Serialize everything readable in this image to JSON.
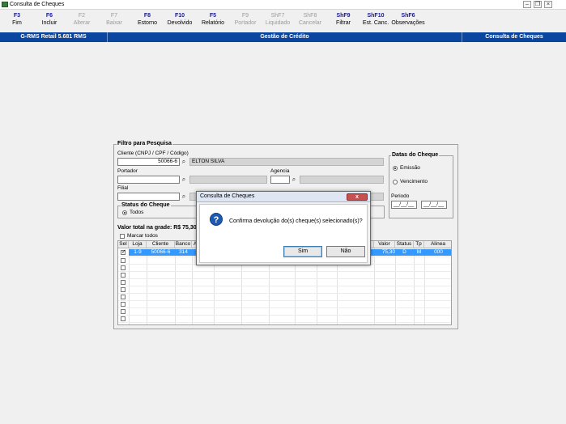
{
  "window": {
    "title": "Consulta de Cheques"
  },
  "toolbar": [
    {
      "key": "F3",
      "label": "Fim",
      "enabled": true
    },
    {
      "key": "F6",
      "label": "Incluir",
      "enabled": true
    },
    {
      "key": "F2",
      "label": "Alterar",
      "enabled": false
    },
    {
      "key": "F7",
      "label": "Baixar",
      "enabled": false
    },
    {
      "key": "F8",
      "label": "Estorno",
      "enabled": true
    },
    {
      "key": "F10",
      "label": "Devolvido",
      "enabled": true
    },
    {
      "key": "F5",
      "label": "Relatório",
      "enabled": true
    },
    {
      "key": "F9",
      "label": "Portador",
      "enabled": false
    },
    {
      "key": "ShF7",
      "label": "Liquidado",
      "enabled": false
    },
    {
      "key": "ShF8",
      "label": "Cancelar",
      "enabled": false
    },
    {
      "key": "ShF9",
      "label": "Filtrar",
      "enabled": true
    },
    {
      "key": "ShF10",
      "label": "Est. Canc.",
      "enabled": true
    },
    {
      "key": "ShF6",
      "label": "Observações",
      "enabled": true
    }
  ],
  "statusbar": {
    "app": "G-RMS Retail 5.681 RMS",
    "module": "Gestão de Crédito",
    "screen": "Consulta de Cheques"
  },
  "filter": {
    "title": "Filtro para Pesquisa",
    "cliente_label": "Cliente (CNPJ / CPF / Código)",
    "cliente_value": "50066-6",
    "cliente_name": "ELTON SILVA",
    "portador_label": "Portador",
    "agencia_label": "Agencia",
    "filial_label": "Filial"
  },
  "status_cheque": {
    "title": "Status do Cheque",
    "todos": "Todos"
  },
  "datas": {
    "title": "Datas do Cheque",
    "emissao": "Emissão",
    "vencimento": "Vencimento",
    "periodo_label": "Periodo",
    "date_from": "__/__/__",
    "date_to": "__/__/__"
  },
  "totals": {
    "label": "Valor total na grade: R$ 75,30",
    "marcar_todos": "Marcar todos"
  },
  "grid": {
    "columns": [
      "Sel",
      "Loja",
      "Cliente",
      "Banco",
      "A",
      "Valor",
      "Status",
      "Tp",
      "Alinea"
    ],
    "row": {
      "loja": "1-9",
      "cliente": "50066-6",
      "banco": "314",
      "valor": "75,30",
      "status": "D",
      "tp": "M",
      "alinea": "000"
    }
  },
  "dialog": {
    "title": "Consulta de Cheques",
    "close": "x",
    "message": "Confirma devolução do(s) cheque(s) selecionado(s)?",
    "yes": "Sim",
    "no": "Não"
  },
  "colors": {
    "accent": "#0a46a0",
    "selection": "#3399ff"
  }
}
